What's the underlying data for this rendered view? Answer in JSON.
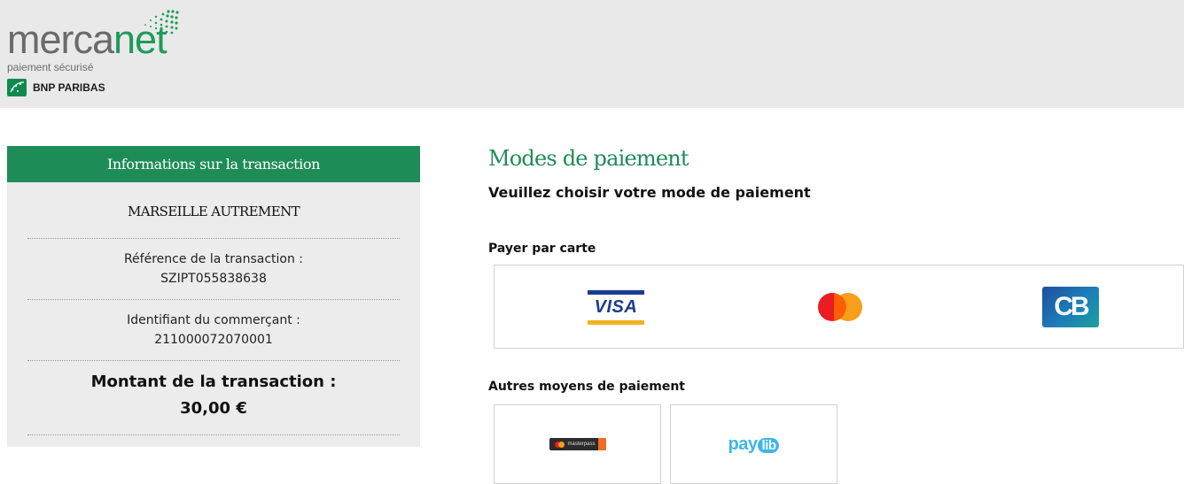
{
  "brand": {
    "wordmark_part1": "merca",
    "wordmark_part2": "net",
    "tagline": "paiement sécurisé",
    "bank": "BNP PARIBAS",
    "green": "#1e8c57"
  },
  "transaction": {
    "header": "Informations sur la transaction",
    "merchant_name": "MARSEILLE AUTREMENT",
    "reference_label": "Référence de la transaction :",
    "reference_value": "SZIPT055838638",
    "merchant_id_label": "Identifiant du commerçant :",
    "merchant_id_value": "211000072070001",
    "amount_label": "Montant de la transaction :",
    "amount_value": "30,00 €"
  },
  "payment": {
    "title": "Modes de paiement",
    "subtitle": "Veuillez choisir votre mode de paiement",
    "card_section": "Payer par carte",
    "cards": [
      {
        "name": "VISA",
        "icon": "visa-logo"
      },
      {
        "name": "Mastercard",
        "icon": "mastercard-logo"
      },
      {
        "name": "CB",
        "icon": "cb-logo"
      }
    ],
    "other_section": "Autres moyens de paiement",
    "others": [
      {
        "name": "masterpass",
        "icon": "masterpass-logo"
      },
      {
        "name_part1": "pay",
        "name_part2": "lib",
        "icon": "paylib-logo"
      }
    ]
  }
}
